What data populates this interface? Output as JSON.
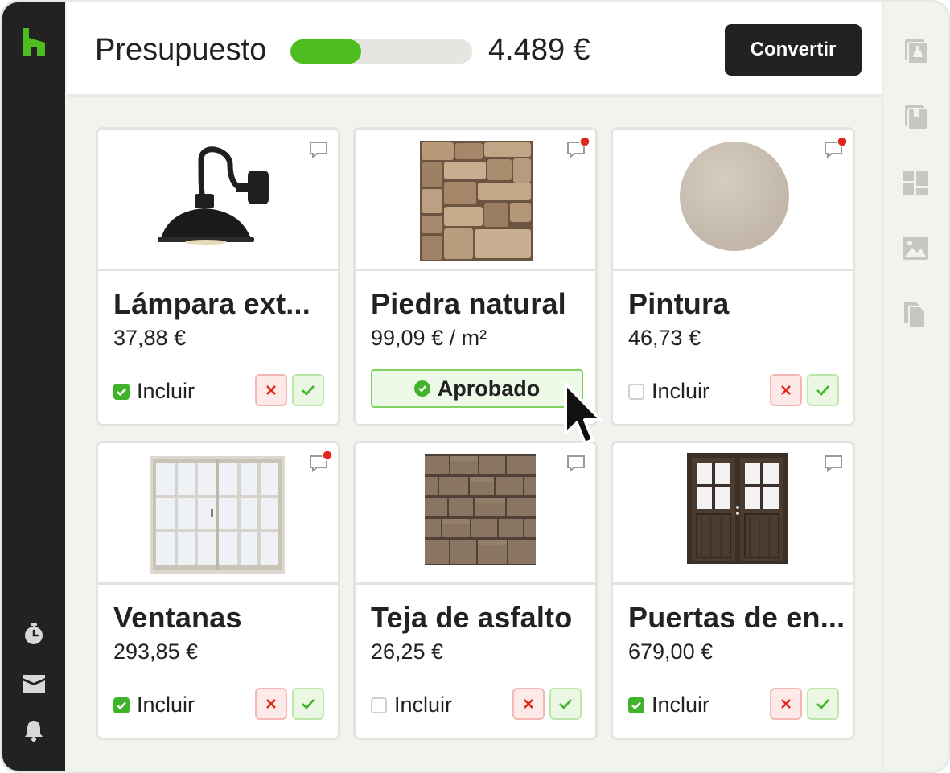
{
  "header": {
    "budget_label": "Presupuesto",
    "budget_amount": "4.489 €",
    "budget_progress_fraction": 0.39,
    "convert_label": "Convertir"
  },
  "colors": {
    "accent_green": "#4dbd1f",
    "dark": "#222222",
    "notification_red": "#e0271b"
  },
  "left_rail": {
    "icons": [
      "houzz-logo-icon",
      "stopwatch-icon",
      "inbox-icon",
      "bell-icon"
    ]
  },
  "right_rail": {
    "tools": [
      "paint-bucket-icon",
      "swatch-book-icon",
      "layout-icon",
      "image-icon",
      "document-icon"
    ]
  },
  "cards": [
    {
      "title": "Lámpara ext...",
      "price": "37,88 €",
      "include_label": "Incluir",
      "included": true,
      "notification": false,
      "image": "lamp-image"
    },
    {
      "title": "Piedra natural",
      "price": "99,09 € / m²",
      "status_label": "Aprobado",
      "notification": true,
      "image": "stone-image"
    },
    {
      "title": "Pintura",
      "price": "46,73 €",
      "include_label": "Incluir",
      "included": false,
      "notification": true,
      "image": "paint-swatch-image"
    },
    {
      "title": "Ventanas",
      "price": "293,85 €",
      "include_label": "Incluir",
      "included": true,
      "notification": true,
      "image": "window-image"
    },
    {
      "title": "Teja de asfalto",
      "price": "26,25 €",
      "include_label": "Incluir",
      "included": false,
      "notification": false,
      "image": "shingle-image"
    },
    {
      "title": "Puertas de en...",
      "price": "679,00 €",
      "include_label": "Incluir",
      "included": true,
      "notification": false,
      "image": "door-image"
    }
  ]
}
